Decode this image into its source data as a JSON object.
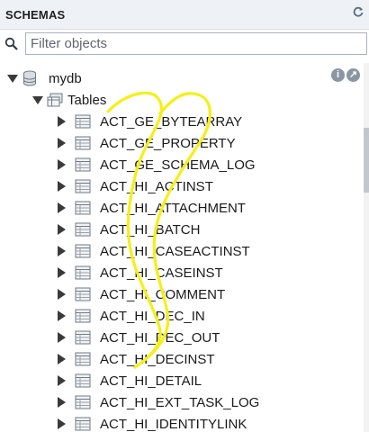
{
  "panel": {
    "title": "SCHEMAS"
  },
  "icons": {
    "refresh": "refresh-icon",
    "search": "search-icon",
    "info": "info-icon",
    "inspect": "inspect-icon"
  },
  "filter": {
    "placeholder": "Filter objects",
    "value": ""
  },
  "tree": {
    "schema": "mydb",
    "group": "Tables",
    "tables": [
      "ACT_GE_BYTEARRAY",
      "ACT_GE_PROPERTY",
      "ACT_GE_SCHEMA_LOG",
      "ACT_HI_ACTINST",
      "ACT_HI_ATTACHMENT",
      "ACT_HI_BATCH",
      "ACT_HI_CASEACTINST",
      "ACT_HI_CASEINST",
      "ACT_HI_COMMENT",
      "ACT_HI_DEC_IN",
      "ACT_HI_DEC_OUT",
      "ACT_HI_DECINST",
      "ACT_HI_DETAIL",
      "ACT_HI_EXT_TASK_LOG",
      "ACT_HI_IDENTITYLINK"
    ]
  },
  "colors": {
    "annotation": "#f5ef1a",
    "header_bg": "#eef1f5",
    "accent": "#5a6f86"
  }
}
